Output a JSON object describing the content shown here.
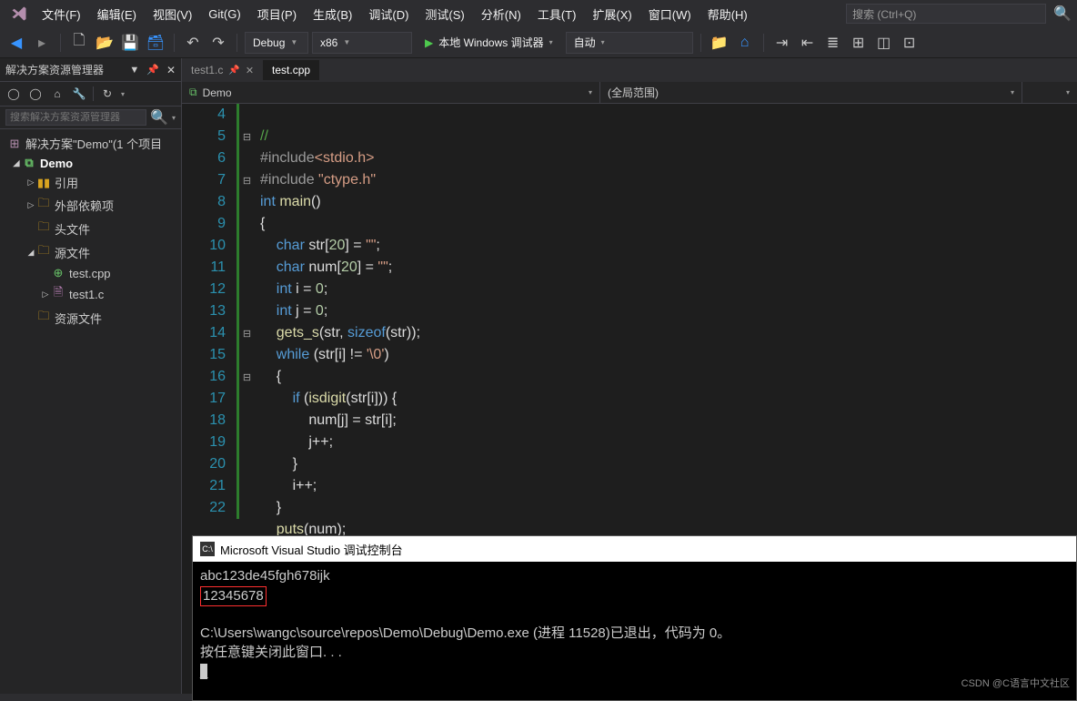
{
  "menu": {
    "items": [
      "文件(F)",
      "编辑(E)",
      "视图(V)",
      "Git(G)",
      "项目(P)",
      "生成(B)",
      "调试(D)",
      "测试(S)",
      "分析(N)",
      "工具(T)",
      "扩展(X)",
      "窗口(W)",
      "帮助(H)"
    ],
    "search_placeholder": "搜索 (Ctrl+Q)"
  },
  "toolbar": {
    "config": "Debug",
    "platform": "x86",
    "run_label": "本地 Windows 调试器",
    "auto": "自动"
  },
  "solution_explorer": {
    "title": "解决方案资源管理器",
    "search_placeholder": "搜索解决方案资源管理器",
    "root": "解决方案\"Demo\"(1 个项目",
    "project": "Demo",
    "nodes": {
      "refs": "引用",
      "ext": "外部依赖项",
      "headers": "头文件",
      "sources": "源文件",
      "resources": "资源文件",
      "file1": "test.cpp",
      "file2": "test1.c"
    }
  },
  "tabs": {
    "t1": "test1.c",
    "t2": "test.cpp"
  },
  "navbar": {
    "scope1": "Demo",
    "scope2": "(全局范围)"
  },
  "code": {
    "line_numbers": [
      "4",
      "5",
      "6",
      "7",
      "8",
      "9",
      "10",
      "11",
      "12",
      "13",
      "14",
      "15",
      "16",
      "17",
      "18",
      "19",
      "20",
      "21",
      "22"
    ],
    "l4": "//",
    "l5_inc": "#include",
    "l5_hdr": "<stdio.h>",
    "l6_inc": "#include ",
    "l6_hdr": "\"ctype.h\"",
    "l7_int": "int ",
    "l7_main": "main",
    "l7_rest": "()",
    "l8": "{",
    "l9_1": "    ",
    "l9_char": "char ",
    "l9_rest": "str[",
    "l9_20": "20",
    "l9_r2": "] = ",
    "l9_str": "\"\"",
    "l9_end": ";",
    "l10_1": "    ",
    "l10_char": "char ",
    "l10_rest": "num[",
    "l10_20": "20",
    "l10_r2": "] = ",
    "l10_str": "\"\"",
    "l10_end": ";",
    "l11_1": "    ",
    "l11_int": "int ",
    "l11_rest": "i = ",
    "l11_0": "0",
    "l11_end": ";",
    "l12_1": "    ",
    "l12_int": "int ",
    "l12_rest": "j = ",
    "l12_0": "0",
    "l12_end": ";",
    "l13_1": "    ",
    "l13_fn": "gets_s",
    "l13_rest": "(str, ",
    "l13_sz": "sizeof",
    "l13_r2": "(str));",
    "l14_1": "    ",
    "l14_while": "while ",
    "l14_rest": "(str[i] != ",
    "l14_ch": "'\\0'",
    "l14_end": ")",
    "l15": "    {",
    "l16_1": "        ",
    "l16_if": "if ",
    "l16_rest": "(",
    "l16_fn": "isdigit",
    "l16_r2": "(str[i])) {",
    "l17_1": "            num[j] = str[i];",
    "l18_1": "            j++;",
    "l19": "        }",
    "l20": "        i++;",
    "l21": "    }",
    "l22_1": "    ",
    "l22_fn": "puts",
    "l22_rest": "(num);"
  },
  "console": {
    "title": "Microsoft Visual Studio 调试控制台",
    "input": "abc123de45fgh678ijk",
    "output": "12345678",
    "exit": "C:\\Users\\wangc\\source\\repos\\Demo\\Debug\\Demo.exe (进程 11528)已退出，代码为 0。",
    "prompt": "按任意键关闭此窗口. . ."
  },
  "watermark": "CSDN @C语言中文社区"
}
